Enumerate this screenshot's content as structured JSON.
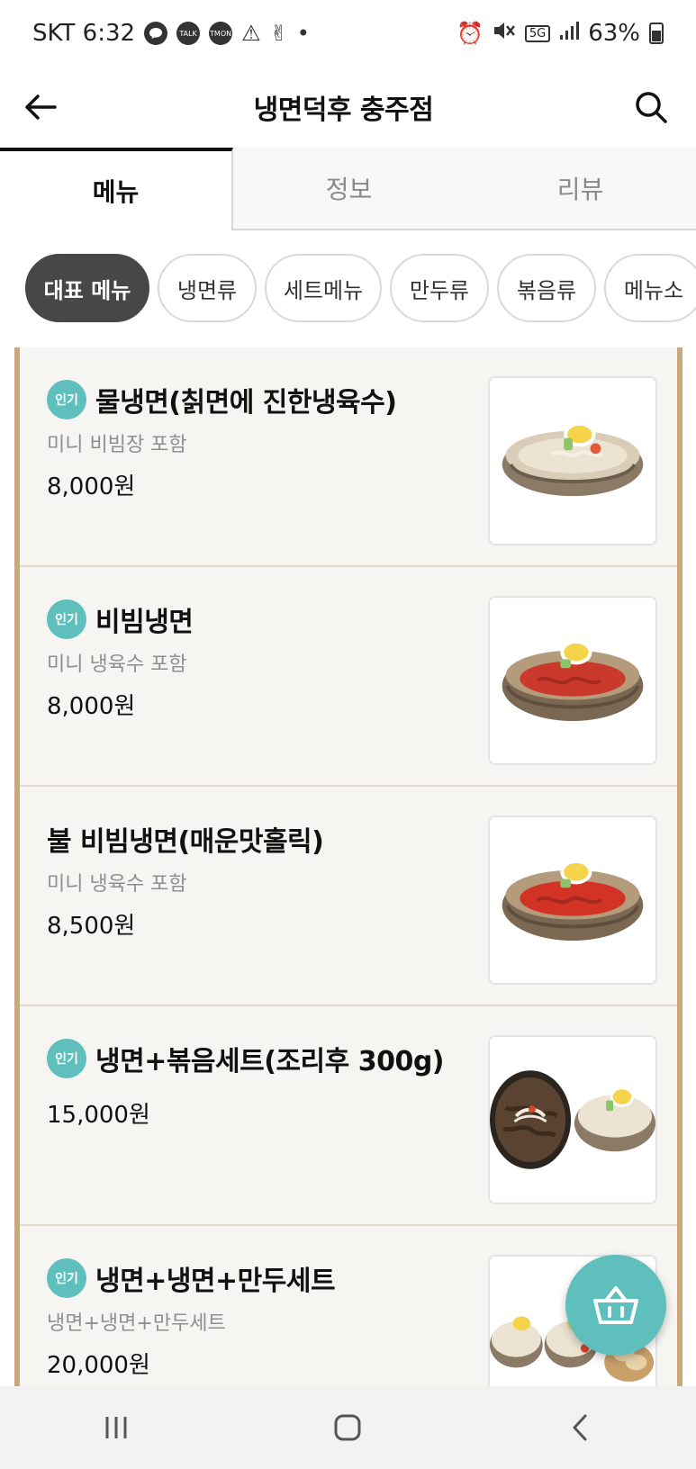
{
  "status_bar": {
    "carrier_time": "SKT 6:32",
    "notif_icons": [
      "chat-bubble-icon",
      "talk-icon",
      "tmon-icon",
      "warning-icon",
      "victory-hand-icon"
    ],
    "talk_label": "TALK",
    "tmon_label": "TMON",
    "network": "5G",
    "battery": "63%"
  },
  "header": {
    "title": "냉면덕후 충주점"
  },
  "tabs": [
    {
      "label": "메뉴",
      "active": true
    },
    {
      "label": "정보",
      "active": false
    },
    {
      "label": "리뷰",
      "active": false
    }
  ],
  "categories": [
    {
      "label": "대표 메뉴",
      "active": true
    },
    {
      "label": "냉면류",
      "active": false
    },
    {
      "label": "세트메뉴",
      "active": false
    },
    {
      "label": "만두류",
      "active": false
    },
    {
      "label": "볶음류",
      "active": false
    },
    {
      "label": "메뉴소",
      "active": false
    }
  ],
  "popular_label": "인기",
  "menu_items": [
    {
      "name": "물냉면(칡면에 진한냉육수)",
      "desc": "미니 비빔장 포함",
      "price": "8,000원",
      "popular": true
    },
    {
      "name": "비빔냉면",
      "desc": "미니 냉육수 포함",
      "price": "8,000원",
      "popular": true
    },
    {
      "name": "불 비빔냉면(매운맛홀릭)",
      "desc": "미니 냉육수 포함",
      "price": "8,500원",
      "popular": false
    },
    {
      "name": "냉면+볶음세트(조리후 300g)",
      "desc": "",
      "price": "15,000원",
      "popular": true
    },
    {
      "name": "냉면+냉면+만두세트",
      "desc": "냉면+냉면+만두세트",
      "price": "20,000원",
      "popular": true
    }
  ],
  "colors": {
    "accent_teal": "#5ebfbd",
    "chip_active": "#474747",
    "menu_border": "#c8a97e",
    "menu_bg": "#f6f5f2"
  }
}
